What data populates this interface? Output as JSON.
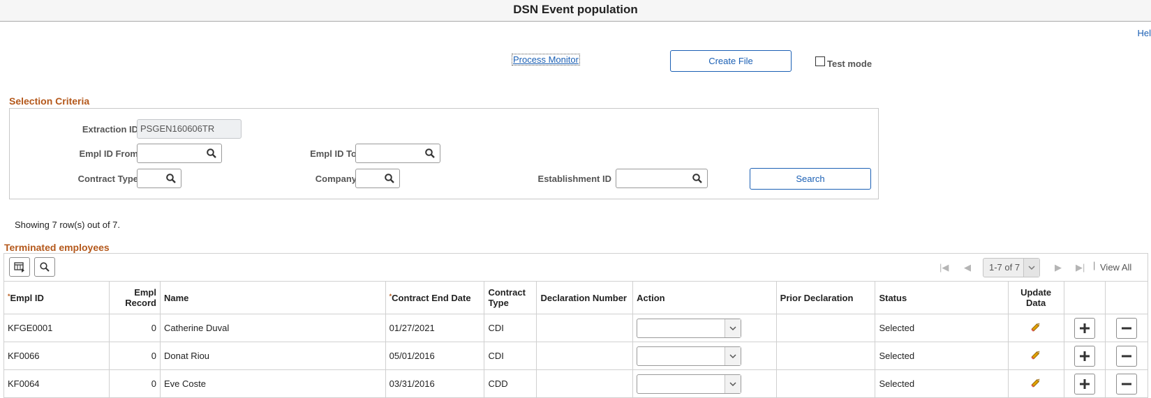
{
  "page": {
    "title": "DSN Event population",
    "help_link": "Hel"
  },
  "top_actions": {
    "process_monitor": "Process Monitor",
    "create_file": "Create File",
    "test_mode_label": "Test mode",
    "test_mode_checked": false
  },
  "selection_criteria": {
    "title": "Selection Criteria",
    "extraction_id_label": "Extraction ID",
    "extraction_id_value": "PSGEN160606TR",
    "empl_id_from_label": "Empl ID From",
    "empl_id_to_label": "Empl ID To",
    "contract_type_label": "Contract Type",
    "company_label": "Company",
    "establishment_id_label": "Establishment ID",
    "search_button": "Search"
  },
  "results": {
    "showing_text": "Showing 7 row(s) out of 7.",
    "grid_title": "Terminated employees",
    "pagination": {
      "range": "1-7 of 7",
      "view_all": "View All"
    },
    "columns": {
      "empl_id": "Empl ID",
      "empl_record": "Empl Record",
      "name": "Name",
      "contract_end_date": "Contract End Date",
      "contract_type": "Contract Type",
      "declaration_number": "Declaration Number",
      "action": "Action",
      "prior_declaration": "Prior Declaration",
      "status": "Status",
      "update_data": "Update Data"
    },
    "rows": [
      {
        "empl_id": "KFGE0001",
        "empl_record": "0",
        "name": "Catherine Duval",
        "contract_end_date": "01/27/2021",
        "contract_type": "CDI",
        "declaration_number": "",
        "action": "",
        "prior_declaration": "",
        "status": "Selected"
      },
      {
        "empl_id": "KF0066",
        "empl_record": "0",
        "name": "Donat Riou",
        "contract_end_date": "05/01/2016",
        "contract_type": "CDI",
        "declaration_number": "",
        "action": "",
        "prior_declaration": "",
        "status": "Selected"
      },
      {
        "empl_id": "KF0064",
        "empl_record": "0",
        "name": "Eve Coste",
        "contract_end_date": "03/31/2016",
        "contract_type": "CDD",
        "declaration_number": "",
        "action": "",
        "prior_declaration": "",
        "status": "Selected"
      }
    ]
  },
  "icons": {
    "search": "magnifier-icon",
    "grid_personalize": "grid-personalize-icon",
    "find": "find-icon",
    "edit": "pencil-icon",
    "add_row": "plus-icon",
    "delete_row": "minus-icon"
  },
  "colors": {
    "link": "#1a5fb4",
    "section_title": "#b4581b",
    "pencil": "#e0a000"
  }
}
